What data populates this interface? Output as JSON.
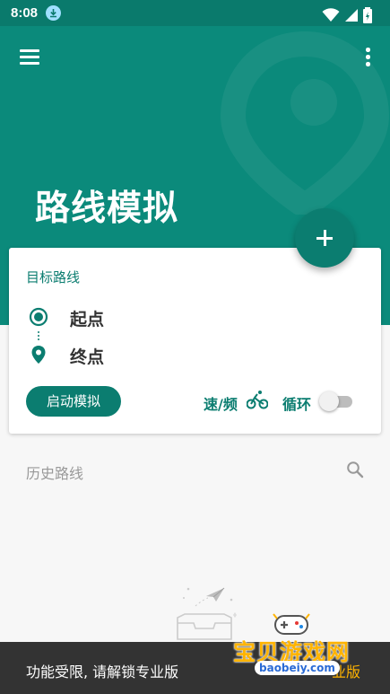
{
  "status_bar": {
    "time": "8:08"
  },
  "header": {
    "title": "路线模拟"
  },
  "route_card": {
    "title": "目标路线",
    "start_label": "起点",
    "end_label": "终点",
    "simulate_button": "启动模拟",
    "speed_label": "速/频",
    "loop_label": "循环",
    "loop_enabled": false
  },
  "history": {
    "title": "历史路线"
  },
  "snackbar": {
    "message": "功能受限, 请解锁专业版",
    "action": "业版"
  },
  "watermark": {
    "brand": "宝贝游戏网",
    "url": "baobeiy.com"
  },
  "colors": {
    "primary": "#0b8a7b",
    "primary_dark": "#0a7a6c",
    "accent_text": "#0b7d70",
    "snackbar": "#333333"
  }
}
